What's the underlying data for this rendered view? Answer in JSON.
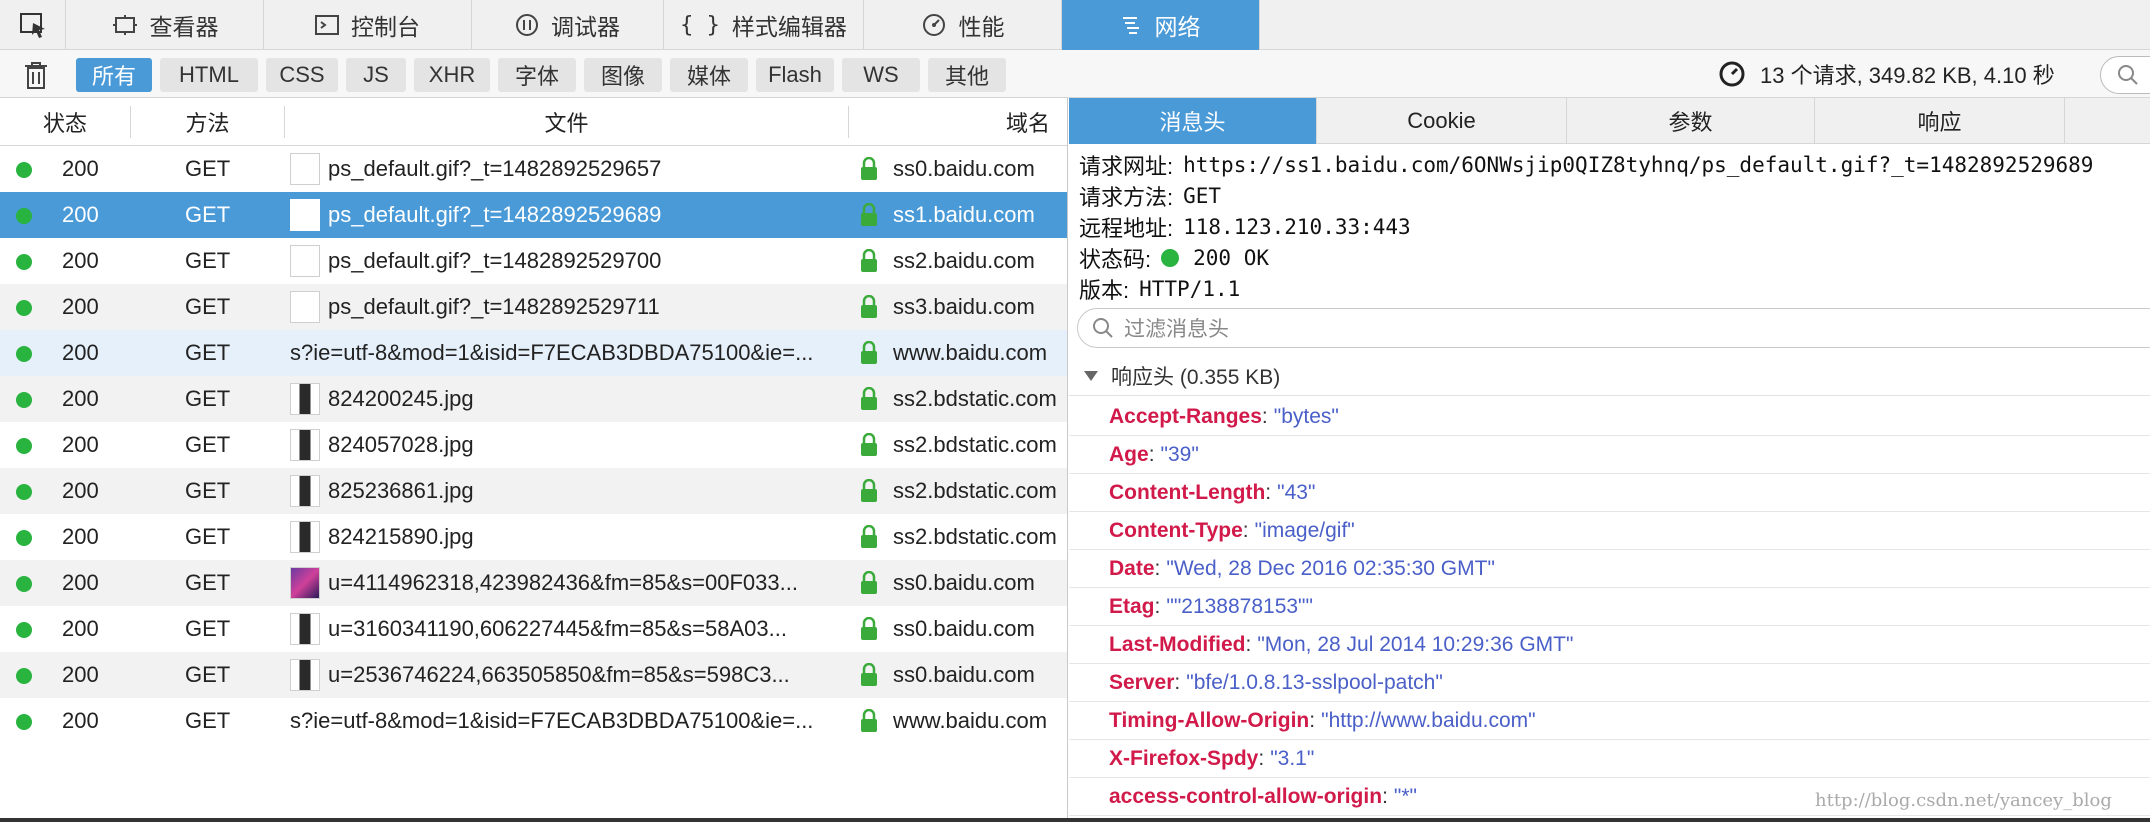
{
  "toolbar": {
    "tabs": [
      {
        "label": "查看器",
        "icon": "inspector-icon"
      },
      {
        "label": "控制台",
        "icon": "console-icon"
      },
      {
        "label": "调试器",
        "icon": "debugger-icon"
      },
      {
        "label": "样式编辑器",
        "icon": "style-editor-icon"
      },
      {
        "label": "性能",
        "icon": "performance-icon"
      },
      {
        "label": "网络",
        "icon": "network-icon",
        "active": true
      }
    ]
  },
  "filters": {
    "buttons": [
      "所有",
      "HTML",
      "CSS",
      "JS",
      "XHR",
      "字体",
      "图像",
      "媒体",
      "Flash",
      "WS",
      "其他"
    ],
    "summary": "13 个请求, 349.82 KB, 4.10 秒"
  },
  "table": {
    "headers": {
      "status": "状态",
      "method": "方法",
      "file": "文件",
      "domain": "域名"
    },
    "rows": [
      {
        "status": "200",
        "method": "GET",
        "file": "ps_default.gif?_t=1482892529657",
        "domain": "ss0.baidu.com",
        "thumb": "blank"
      },
      {
        "status": "200",
        "method": "GET",
        "file": "ps_default.gif?_t=1482892529689",
        "domain": "ss1.baidu.com",
        "thumb": "blank",
        "selected": true
      },
      {
        "status": "200",
        "method": "GET",
        "file": "ps_default.gif?_t=1482892529700",
        "domain": "ss2.baidu.com",
        "thumb": "blank"
      },
      {
        "status": "200",
        "method": "GET",
        "file": "ps_default.gif?_t=1482892529711",
        "domain": "ss3.baidu.com",
        "thumb": "blank"
      },
      {
        "status": "200",
        "method": "GET",
        "file": "s?ie=utf-8&mod=1&isid=F7ECAB3DBDA75100&ie=...",
        "domain": "www.baidu.com",
        "thumb": "none",
        "hover": true
      },
      {
        "status": "200",
        "method": "GET",
        "file": "824200245.jpg",
        "domain": "ss2.bdstatic.com",
        "thumb": "phone"
      },
      {
        "status": "200",
        "method": "GET",
        "file": "824057028.jpg",
        "domain": "ss2.bdstatic.com",
        "thumb": "phone"
      },
      {
        "status": "200",
        "method": "GET",
        "file": "825236861.jpg",
        "domain": "ss2.bdstatic.com",
        "thumb": "phone"
      },
      {
        "status": "200",
        "method": "GET",
        "file": "824215890.jpg",
        "domain": "ss2.bdstatic.com",
        "thumb": "phone"
      },
      {
        "status": "200",
        "method": "GET",
        "file": "u=4114962318,423982436&fm=85&s=00F033...",
        "domain": "ss0.baidu.com",
        "thumb": "image"
      },
      {
        "status": "200",
        "method": "GET",
        "file": "u=3160341190,606227445&fm=85&s=58A03...",
        "domain": "ss0.baidu.com",
        "thumb": "phone"
      },
      {
        "status": "200",
        "method": "GET",
        "file": "u=2536746224,663505850&fm=85&s=598C3...",
        "domain": "ss0.baidu.com",
        "thumb": "phone"
      },
      {
        "status": "200",
        "method": "GET",
        "file": "s?ie=utf-8&mod=1&isid=F7ECAB3DBDA75100&ie=...",
        "domain": "www.baidu.com",
        "thumb": "none"
      }
    ]
  },
  "detail": {
    "tabs": [
      "消息头",
      "Cookie",
      "参数",
      "响应"
    ],
    "summary": [
      {
        "key": "请求网址:",
        "value": "https://ss1.baidu.com/6ONWsjip0QIZ8tyhnq/ps_default.gif?_t=1482892529689"
      },
      {
        "key": "请求方法:",
        "value": "GET"
      },
      {
        "key": "远程地址:",
        "value": "118.123.210.33:443"
      },
      {
        "key": "状态码:",
        "value": "200 OK",
        "status_dot": true
      },
      {
        "key": "版本:",
        "value": "HTTP/1.1"
      }
    ],
    "filter_placeholder": "过滤消息头",
    "section_title": "响应头 (0.355 KB)",
    "headers": [
      {
        "name": "Accept-Ranges",
        "value": "\"bytes\""
      },
      {
        "name": "Age",
        "value": "\"39\""
      },
      {
        "name": "Content-Length",
        "value": "\"43\""
      },
      {
        "name": "Content-Type",
        "value": "\"image/gif\""
      },
      {
        "name": "Date",
        "value": "\"Wed, 28 Dec 2016 02:35:30 GMT\""
      },
      {
        "name": "Etag",
        "value": "\"\"2138878153\"\""
      },
      {
        "name": "Last-Modified",
        "value": "\"Mon, 28 Jul 2014 10:29:36 GMT\""
      },
      {
        "name": "Server",
        "value": "\"bfe/1.0.8.13-sslpool-patch\""
      },
      {
        "name": "Timing-Allow-Origin",
        "value": "\"http://www.baidu.com\""
      },
      {
        "name": "X-Firefox-Spdy",
        "value": "\"3.1\""
      },
      {
        "name": "access-control-allow-origin",
        "value": "\"*\""
      }
    ]
  },
  "watermark": "http://blog.csdn.net/yancey_blog",
  "colors": {
    "accent": "#4a9ad8",
    "status_ok": "#29b33f",
    "header_name": "#d11a4a",
    "header_value": "#4a5fc8"
  }
}
